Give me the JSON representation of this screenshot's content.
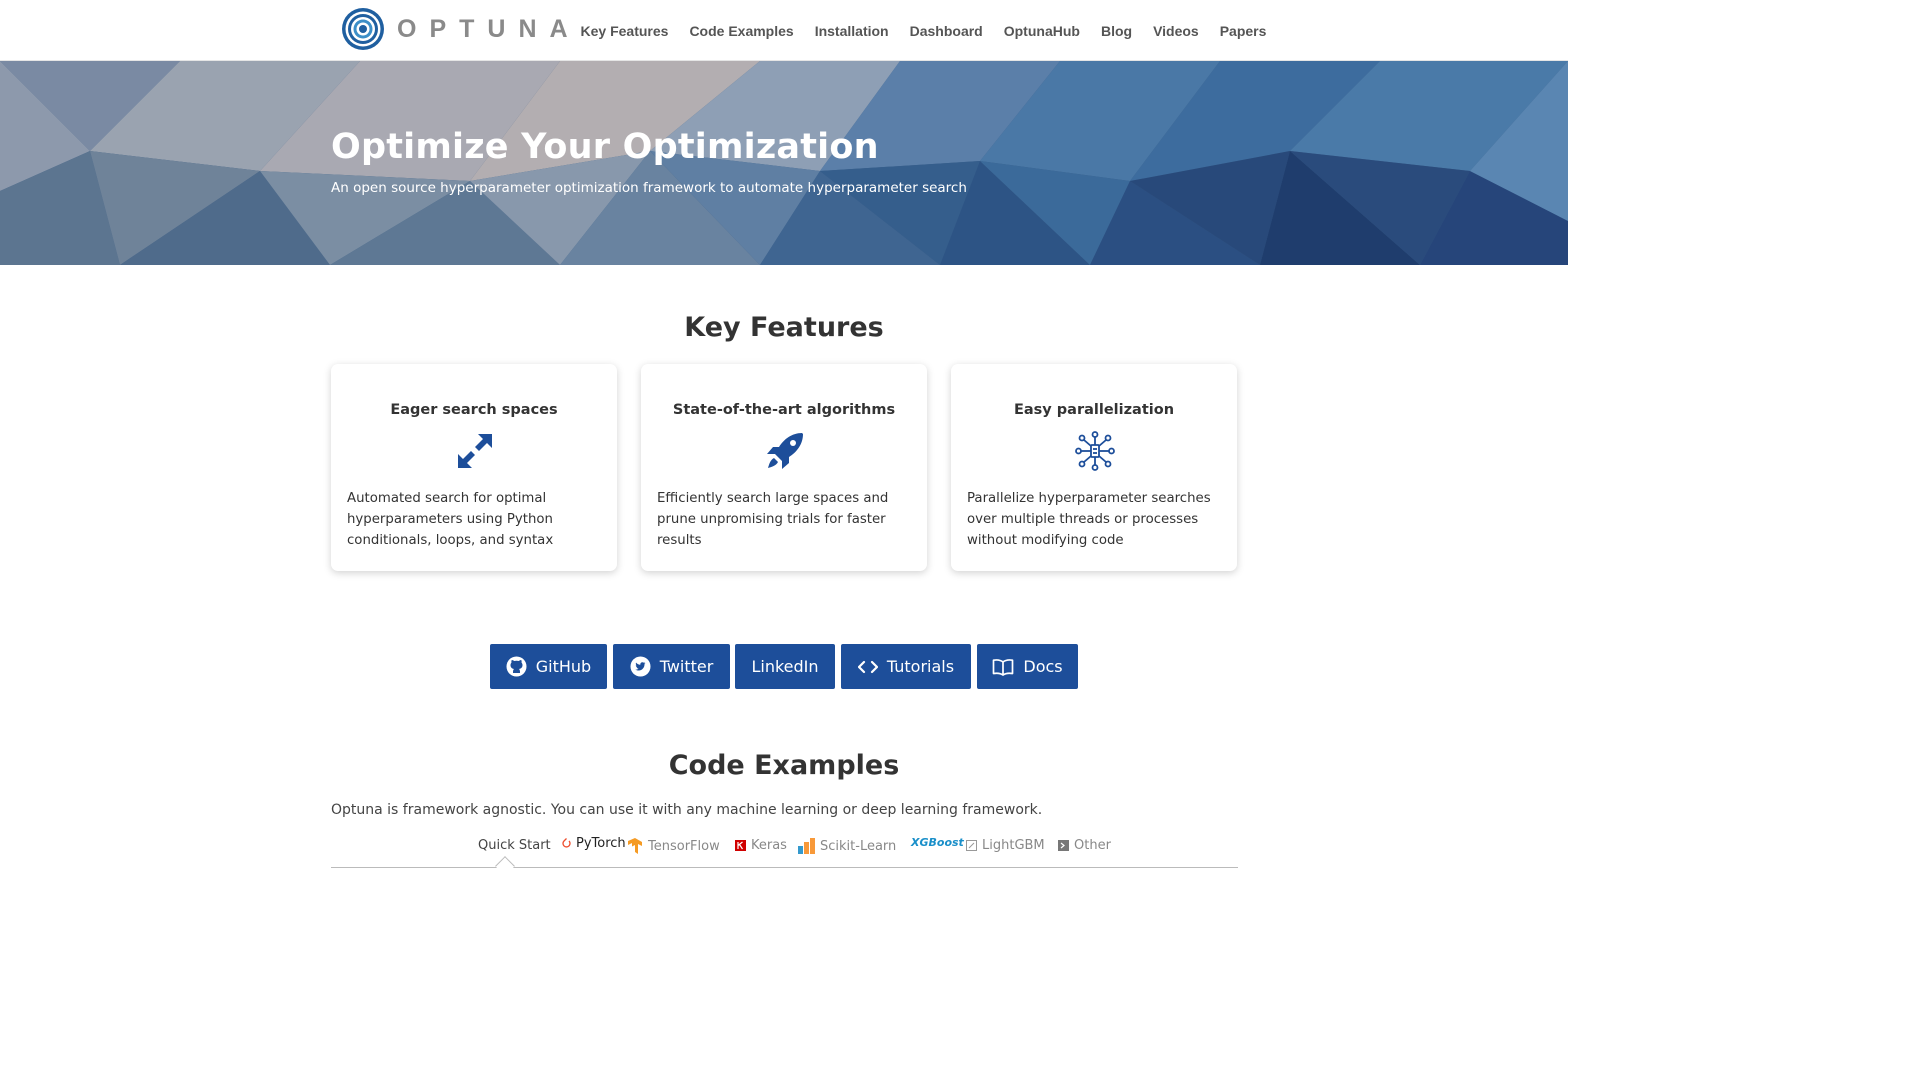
{
  "navbar": {
    "logo_text": "OPTUNA",
    "links": [
      "Key Features",
      "Code Examples",
      "Installation",
      "Dashboard",
      "OptunaHub",
      "Blog",
      "Videos",
      "Papers"
    ]
  },
  "hero": {
    "title": "Optimize Your Optimization",
    "subtitle": "An open source hyperparameter optimization framework to automate hyperparameter search"
  },
  "key_features": {
    "title": "Key Features",
    "cards": [
      {
        "title": "Eager search spaces",
        "icon": "expand-arrows-icon",
        "text": "Automated search for optimal hyperparameters using Python conditionals, loops, and syntax"
      },
      {
        "title": "State-of-the-art algorithms",
        "icon": "rocket-icon",
        "text": "Efficiently search large spaces and prune unpromising trials for faster results"
      },
      {
        "title": "Easy parallelization",
        "icon": "network-icon",
        "text": "Parallelize hyperparameter searches over multiple threads or processes without modifying code"
      }
    ]
  },
  "buttons": [
    {
      "label": "GitHub",
      "icon": "github-icon"
    },
    {
      "label": "Twitter",
      "icon": "twitter-icon"
    },
    {
      "label": "LinkedIn",
      "icon": ""
    },
    {
      "label": "Tutorials",
      "icon": "code-icon"
    },
    {
      "label": "Docs",
      "icon": "book-icon"
    }
  ],
  "code_examples": {
    "title": "Code Examples",
    "description": "Optuna is framework agnostic. You can use it with any machine learning or deep learning framework.",
    "tabs": [
      {
        "label": "Quick Start",
        "active": true
      },
      {
        "label": "PyTorch",
        "active": false
      },
      {
        "label": "TensorFlow",
        "active": false
      },
      {
        "label": "Keras",
        "active": false
      },
      {
        "label": "Scikit-Learn",
        "active": false
      },
      {
        "label": "XGBoost",
        "active": false
      },
      {
        "label": "LightGBM",
        "active": false
      },
      {
        "label": "Other",
        "active": false
      }
    ]
  },
  "colors": {
    "accent": "#1d4e9a",
    "hero_dark": "#23416e",
    "text": "#333333"
  }
}
